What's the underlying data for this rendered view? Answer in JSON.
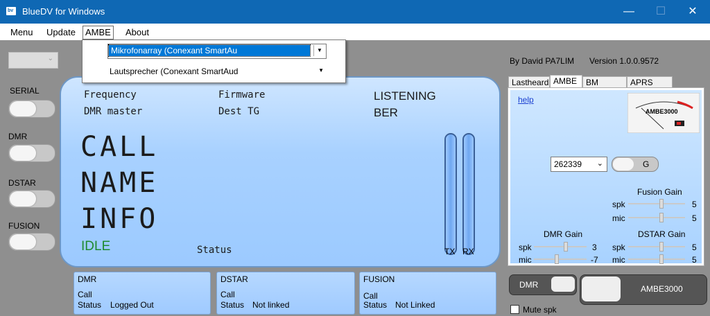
{
  "window": {
    "title": "BlueDV for Windows",
    "minimize": "—",
    "maximize": "☐",
    "close": "✕"
  },
  "menu": {
    "items": [
      "Menu",
      "Update",
      "AMBE",
      "About"
    ]
  },
  "dropdown": {
    "mic_device": "Mikrofonarray (Conexant SmartAu",
    "speaker_device": "Lautsprecher (Conexant SmartAud"
  },
  "sidebar": {
    "labels": [
      "SERIAL",
      "DMR",
      "DSTAR",
      "FUSION"
    ]
  },
  "display": {
    "frequency": "Frequency",
    "dmr_master": "DMR master",
    "firmware": "Firmware",
    "dest_tg": "Dest TG",
    "listening": "LISTENING",
    "ber": "BER",
    "call": "CALL",
    "name": "NAME",
    "info": "INFO",
    "idle": "IDLE",
    "status": "Status",
    "tx": "TX",
    "rx": "RX"
  },
  "panels": [
    {
      "title": "DMR",
      "call": "Call",
      "status_label": "Status",
      "status_value": "Logged Out"
    },
    {
      "title": "DSTAR",
      "call": "Call",
      "status_label": "Status",
      "status_value": "Not linked"
    },
    {
      "title": "FUSION",
      "call": "Call",
      "status_label": "Status",
      "status_value": "Not Linked"
    }
  ],
  "right": {
    "author": "By David PA7LIM",
    "version": "Version 1.0.0.9572",
    "tabs": [
      "Lastheard",
      "AMBE",
      "BM lookup",
      "APRS chat"
    ],
    "help": "help",
    "meter_label": "AMBE3000",
    "combo_value": "262339",
    "g_button": "G",
    "fusion_gain": "Fusion Gain",
    "dmr_gain": "DMR Gain",
    "dstar_gain": "DSTAR Gain",
    "spk": "spk",
    "mic": "mic",
    "fusion_spk": "5",
    "fusion_mic": "5",
    "dmr_spk": "3",
    "dmr_mic": "-7",
    "dstar_spk": "5",
    "dstar_mic": "5"
  },
  "bottom_right": {
    "dmr": "DMR",
    "ambe": "AMBE3000",
    "mute": "Mute spk"
  },
  "colors": {
    "titlebar": "#0f68b4",
    "idle": "#1e8a2e",
    "lcd": "#a8d1ff"
  }
}
